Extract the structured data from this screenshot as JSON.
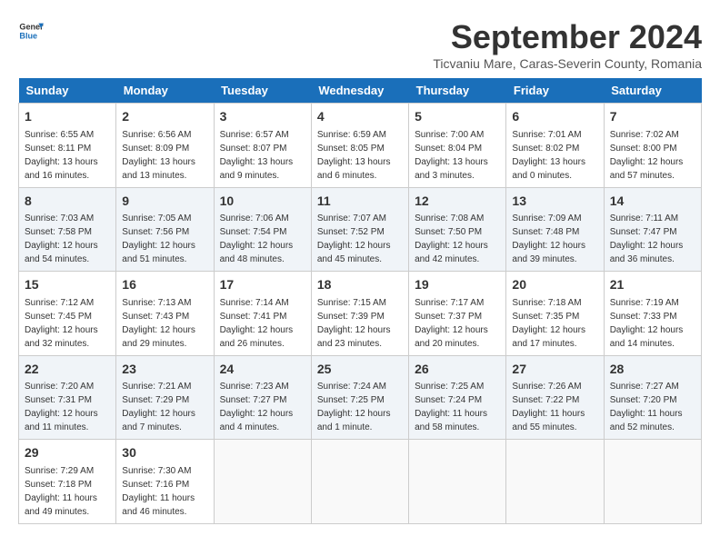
{
  "header": {
    "logo_line1": "General",
    "logo_line2": "Blue",
    "month_title": "September 2024",
    "location": "Ticvaniu Mare, Caras-Severin County, Romania"
  },
  "weekdays": [
    "Sunday",
    "Monday",
    "Tuesday",
    "Wednesday",
    "Thursday",
    "Friday",
    "Saturday"
  ],
  "weeks": [
    [
      {
        "day": "1",
        "info": "Sunrise: 6:55 AM\nSunset: 8:11 PM\nDaylight: 13 hours\nand 16 minutes."
      },
      {
        "day": "2",
        "info": "Sunrise: 6:56 AM\nSunset: 8:09 PM\nDaylight: 13 hours\nand 13 minutes."
      },
      {
        "day": "3",
        "info": "Sunrise: 6:57 AM\nSunset: 8:07 PM\nDaylight: 13 hours\nand 9 minutes."
      },
      {
        "day": "4",
        "info": "Sunrise: 6:59 AM\nSunset: 8:05 PM\nDaylight: 13 hours\nand 6 minutes."
      },
      {
        "day": "5",
        "info": "Sunrise: 7:00 AM\nSunset: 8:04 PM\nDaylight: 13 hours\nand 3 minutes."
      },
      {
        "day": "6",
        "info": "Sunrise: 7:01 AM\nSunset: 8:02 PM\nDaylight: 13 hours\nand 0 minutes."
      },
      {
        "day": "7",
        "info": "Sunrise: 7:02 AM\nSunset: 8:00 PM\nDaylight: 12 hours\nand 57 minutes."
      }
    ],
    [
      {
        "day": "8",
        "info": "Sunrise: 7:03 AM\nSunset: 7:58 PM\nDaylight: 12 hours\nand 54 minutes."
      },
      {
        "day": "9",
        "info": "Sunrise: 7:05 AM\nSunset: 7:56 PM\nDaylight: 12 hours\nand 51 minutes."
      },
      {
        "day": "10",
        "info": "Sunrise: 7:06 AM\nSunset: 7:54 PM\nDaylight: 12 hours\nand 48 minutes."
      },
      {
        "day": "11",
        "info": "Sunrise: 7:07 AM\nSunset: 7:52 PM\nDaylight: 12 hours\nand 45 minutes."
      },
      {
        "day": "12",
        "info": "Sunrise: 7:08 AM\nSunset: 7:50 PM\nDaylight: 12 hours\nand 42 minutes."
      },
      {
        "day": "13",
        "info": "Sunrise: 7:09 AM\nSunset: 7:48 PM\nDaylight: 12 hours\nand 39 minutes."
      },
      {
        "day": "14",
        "info": "Sunrise: 7:11 AM\nSunset: 7:47 PM\nDaylight: 12 hours\nand 36 minutes."
      }
    ],
    [
      {
        "day": "15",
        "info": "Sunrise: 7:12 AM\nSunset: 7:45 PM\nDaylight: 12 hours\nand 32 minutes."
      },
      {
        "day": "16",
        "info": "Sunrise: 7:13 AM\nSunset: 7:43 PM\nDaylight: 12 hours\nand 29 minutes."
      },
      {
        "day": "17",
        "info": "Sunrise: 7:14 AM\nSunset: 7:41 PM\nDaylight: 12 hours\nand 26 minutes."
      },
      {
        "day": "18",
        "info": "Sunrise: 7:15 AM\nSunset: 7:39 PM\nDaylight: 12 hours\nand 23 minutes."
      },
      {
        "day": "19",
        "info": "Sunrise: 7:17 AM\nSunset: 7:37 PM\nDaylight: 12 hours\nand 20 minutes."
      },
      {
        "day": "20",
        "info": "Sunrise: 7:18 AM\nSunset: 7:35 PM\nDaylight: 12 hours\nand 17 minutes."
      },
      {
        "day": "21",
        "info": "Sunrise: 7:19 AM\nSunset: 7:33 PM\nDaylight: 12 hours\nand 14 minutes."
      }
    ],
    [
      {
        "day": "22",
        "info": "Sunrise: 7:20 AM\nSunset: 7:31 PM\nDaylight: 12 hours\nand 11 minutes."
      },
      {
        "day": "23",
        "info": "Sunrise: 7:21 AM\nSunset: 7:29 PM\nDaylight: 12 hours\nand 7 minutes."
      },
      {
        "day": "24",
        "info": "Sunrise: 7:23 AM\nSunset: 7:27 PM\nDaylight: 12 hours\nand 4 minutes."
      },
      {
        "day": "25",
        "info": "Sunrise: 7:24 AM\nSunset: 7:25 PM\nDaylight: 12 hours\nand 1 minute."
      },
      {
        "day": "26",
        "info": "Sunrise: 7:25 AM\nSunset: 7:24 PM\nDaylight: 11 hours\nand 58 minutes."
      },
      {
        "day": "27",
        "info": "Sunrise: 7:26 AM\nSunset: 7:22 PM\nDaylight: 11 hours\nand 55 minutes."
      },
      {
        "day": "28",
        "info": "Sunrise: 7:27 AM\nSunset: 7:20 PM\nDaylight: 11 hours\nand 52 minutes."
      }
    ],
    [
      {
        "day": "29",
        "info": "Sunrise: 7:29 AM\nSunset: 7:18 PM\nDaylight: 11 hours\nand 49 minutes."
      },
      {
        "day": "30",
        "info": "Sunrise: 7:30 AM\nSunset: 7:16 PM\nDaylight: 11 hours\nand 46 minutes."
      },
      {
        "day": "",
        "info": ""
      },
      {
        "day": "",
        "info": ""
      },
      {
        "day": "",
        "info": ""
      },
      {
        "day": "",
        "info": ""
      },
      {
        "day": "",
        "info": ""
      }
    ]
  ]
}
